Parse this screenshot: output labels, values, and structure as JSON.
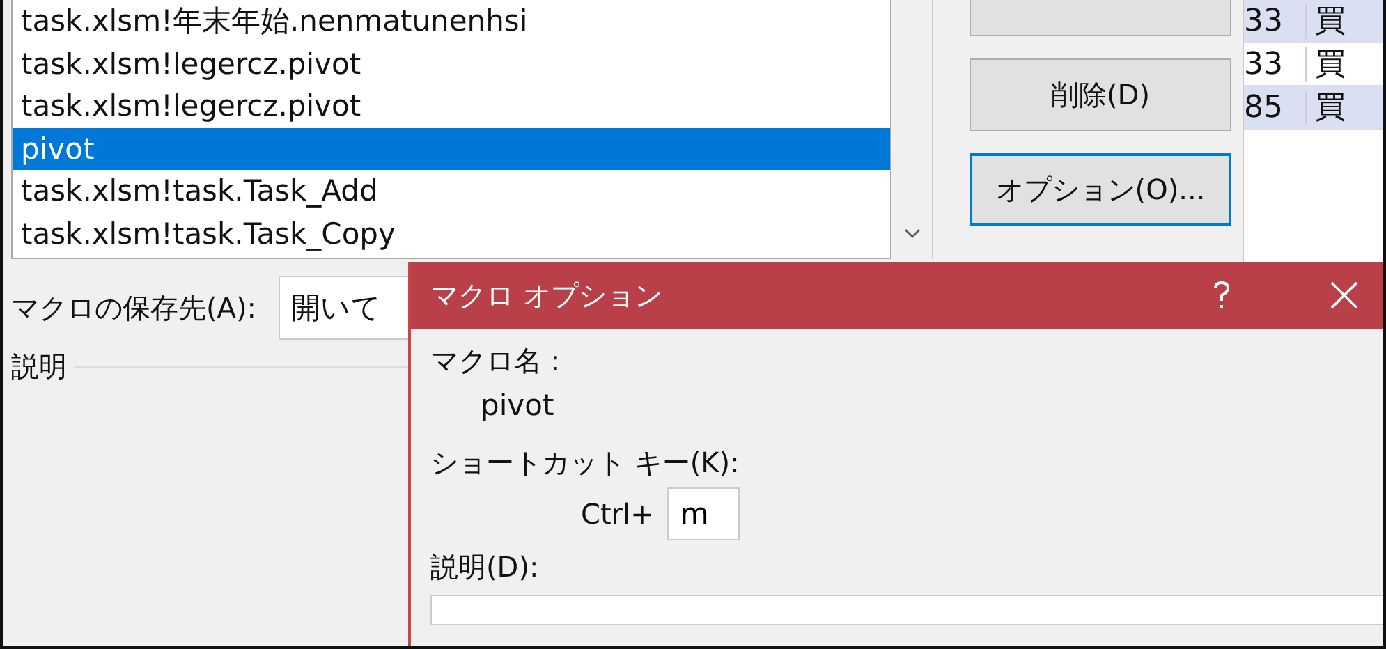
{
  "macro_dialog": {
    "macro_list": [
      {
        "label": "task.xlsm!年末年始.nenmatunenhsi",
        "selected": false
      },
      {
        "label": "task.xlsm!legercz.pivot",
        "selected": false
      },
      {
        "label": "task.xlsm!legercz.pivot",
        "selected": false
      },
      {
        "label": "pivot",
        "selected": true
      },
      {
        "label": "task.xlsm!task.Task_Add",
        "selected": false
      },
      {
        "label": "task.xlsm!task.Task_Copy",
        "selected": false
      }
    ],
    "buttons": [
      {
        "focused": false
      },
      {
        "label": "削除(D)",
        "focused": false
      },
      {
        "label": "オプション(O)...",
        "focused": true
      }
    ],
    "save_location_label": "マクロの保存先(A):",
    "save_location_value": "開いて",
    "description_label": "説明"
  },
  "sheet_rows": [
    [
      "33",
      "買"
    ],
    [
      "33",
      "買"
    ],
    [
      "85",
      "買"
    ]
  ],
  "options_dialog": {
    "title": "マクロ オプション",
    "macro_name_label": "マクロ名 :",
    "macro_name": "pivot",
    "shortcut_label": "ショートカット キー(K):",
    "ctrl_label": "Ctrl+",
    "shortcut_key": "m",
    "description_label": "説明(D):"
  }
}
